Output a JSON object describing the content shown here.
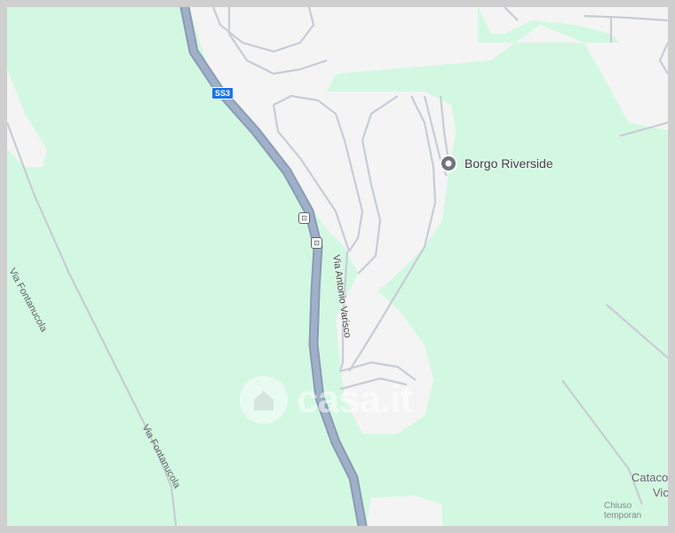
{
  "map": {
    "colors": {
      "green_area": "#d3f8e2",
      "urban_area": "#f4f4f4",
      "main_road": "#94a3b8",
      "minor_road": "#c8ccd4",
      "poi_pin": "#70757a",
      "route_shield": "#1a73e8"
    },
    "route_shield": "SS3",
    "roads": [
      {
        "name": "Via Fontanucola"
      },
      {
        "name": "Via Fontanucola"
      },
      {
        "name": "Via Antonio Varisco"
      }
    ],
    "pois": [
      {
        "name": "Borgo Riverside",
        "icon": "location-pin-icon"
      },
      {
        "name_line1": "Catacom",
        "name_line2": "Vice",
        "status": "Chiuso temporan"
      }
    ],
    "transit_stop_icon": "bus-icon",
    "watermark": {
      "text": "casa.it",
      "icon": "house-icon"
    }
  }
}
